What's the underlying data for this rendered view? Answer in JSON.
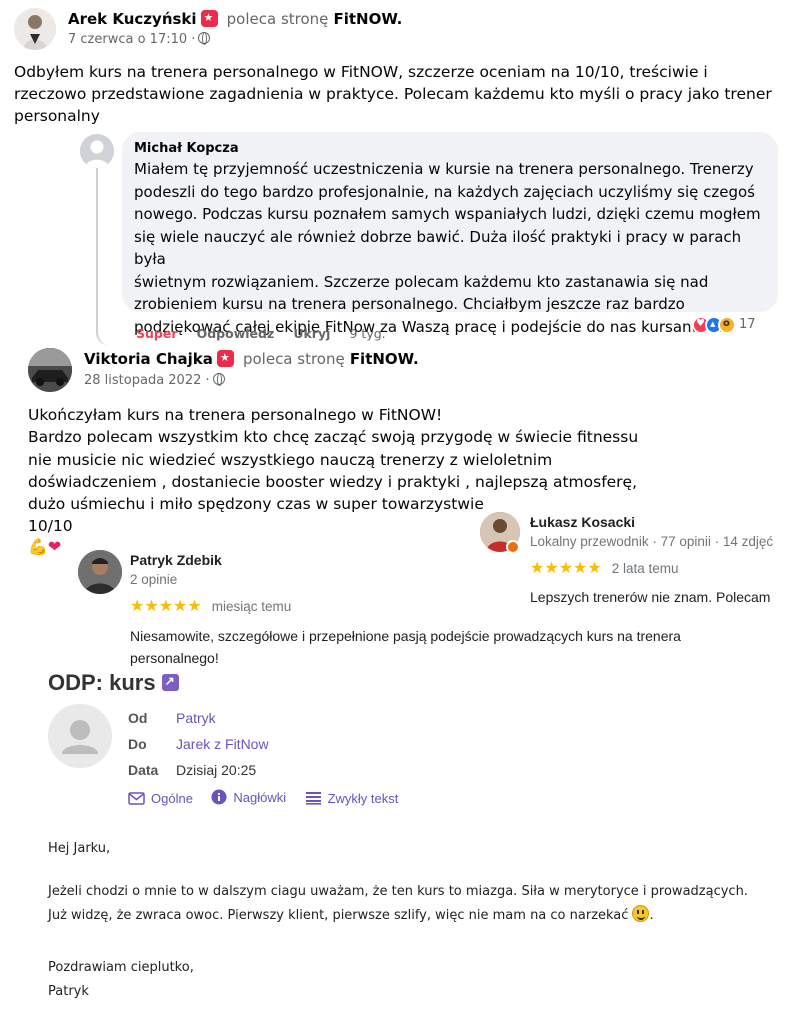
{
  "post1": {
    "author": "Arek Kuczyński",
    "recommends_text": "poleca stronę",
    "page": "FitNOW.",
    "date": "7 czerwca o 17:10 ·",
    "text_lines": [
      "Odbyłem kurs na trenera personalnego w FitNOW, szczerze oceniam na 10/10, treściwie i",
      "rzeczowo przedstawione zagadnienia w praktyce. Polecam każdemu kto myśli o pracy jako trener",
      "personalny"
    ]
  },
  "comment": {
    "author": "Michał Kopcza",
    "text_lines": [
      "Miałem tę przyjemność uczestniczenia w kursie na trenera personalnego. Trenerzy",
      "podeszli do tego bardzo profesjonalnie, na każdych zajęciach uczyliśmy się czegoś",
      "nowego. Podczas kursu poznałem samych wspaniałych ludzi, dzięki czemu mogłem",
      "się wiele nauczyć ale również dobrze bawić. Duża ilość praktyki i pracy w parach była",
      "świetnym rozwiązaniem. Szczerze polecam każdemu kto zastanawia się nad",
      "zrobieniem kursu na trenera personalnego. Chciałbym jeszcze raz bardzo",
      "podziękować całej ekipie FitNow za Waszą pracę i podejście do nas kursantów."
    ],
    "actions": {
      "super": "Super",
      "reply": "Odpowiedz",
      "hide": "Ukryj",
      "time": "9 tyg."
    },
    "reactions_count": "17",
    "reaction_icons": [
      "heart-icon",
      "like-icon",
      "wow-icon"
    ]
  },
  "post2": {
    "author": "Viktoria Chajka",
    "recommends_text": "poleca stronę",
    "page": "FitNOW.",
    "date": "28 listopada 2022 ·",
    "text_lines": [
      "Ukończyłam kurs na trenera personalnego w FitNOW!",
      "Bardzo polecam wszystkim kto chcę zacząć swoją przygodę w świecie fitnessu",
      "nie musicie nic wiedzieć wszystkiego nauczą trenerzy z wieloletnim",
      "doświadczeniem , dostaniecie booster wiedzy i praktyki , najlepszą atmosferę,",
      "dużo uśmiechu i miło spędzony czas w super towarzystwie",
      "10/10"
    ],
    "emojis": "💪❤"
  },
  "review_lukasz": {
    "author": "Łukasz Kosacki",
    "subtitle": "Lokalny przewodnik · 77 opinii · 14 zdjęć",
    "stars": "★★★★★",
    "rating": 5,
    "ago": "2 lata temu",
    "text": "Lepszych trenerów nie znam. Polecam"
  },
  "review_patryk": {
    "author": "Patryk Zdebik",
    "subtitle": "2 opinie",
    "stars": "★★★★★",
    "rating": 5,
    "ago": "miesiąc temu",
    "text_lines": [
      "Niesamowite, szczegółowe i przepełnione pasją podejście prowadzących kurs na trenera",
      "personalnego!"
    ]
  },
  "email": {
    "subject": "ODP: kurs",
    "from_label": "Od",
    "from_value": "Patryk",
    "to_label": "Do",
    "to_value": "Jarek z FitNow",
    "date_label": "Data",
    "date_value": "Dzisiaj 20:25",
    "tabs": [
      "Ogólne",
      "Nagłówki",
      "Zwykły tekst"
    ],
    "greeting": "Hej Jarku,",
    "body_lines": [
      "Jeżeli chodzi o mnie to w dalszym ciagu uważam, że ten kurs to miazga. Siła w merytoryce i prowadzących.",
      "Już widzę, że zwraca owoc. Pierwszy klient, pierwsze szlify, więc nie mam na co narzekać"
    ],
    "closing": "Pozdrawiam cieplutko,",
    "signature": "Patryk"
  },
  "colors": {
    "facebook_text": "#050505",
    "facebook_muted": "#65676b",
    "recommend_badge": "#f02849",
    "super_reaction": "#f33e58",
    "star_yellow": "#fbbc04",
    "mail_accent": "#6b52c0"
  }
}
